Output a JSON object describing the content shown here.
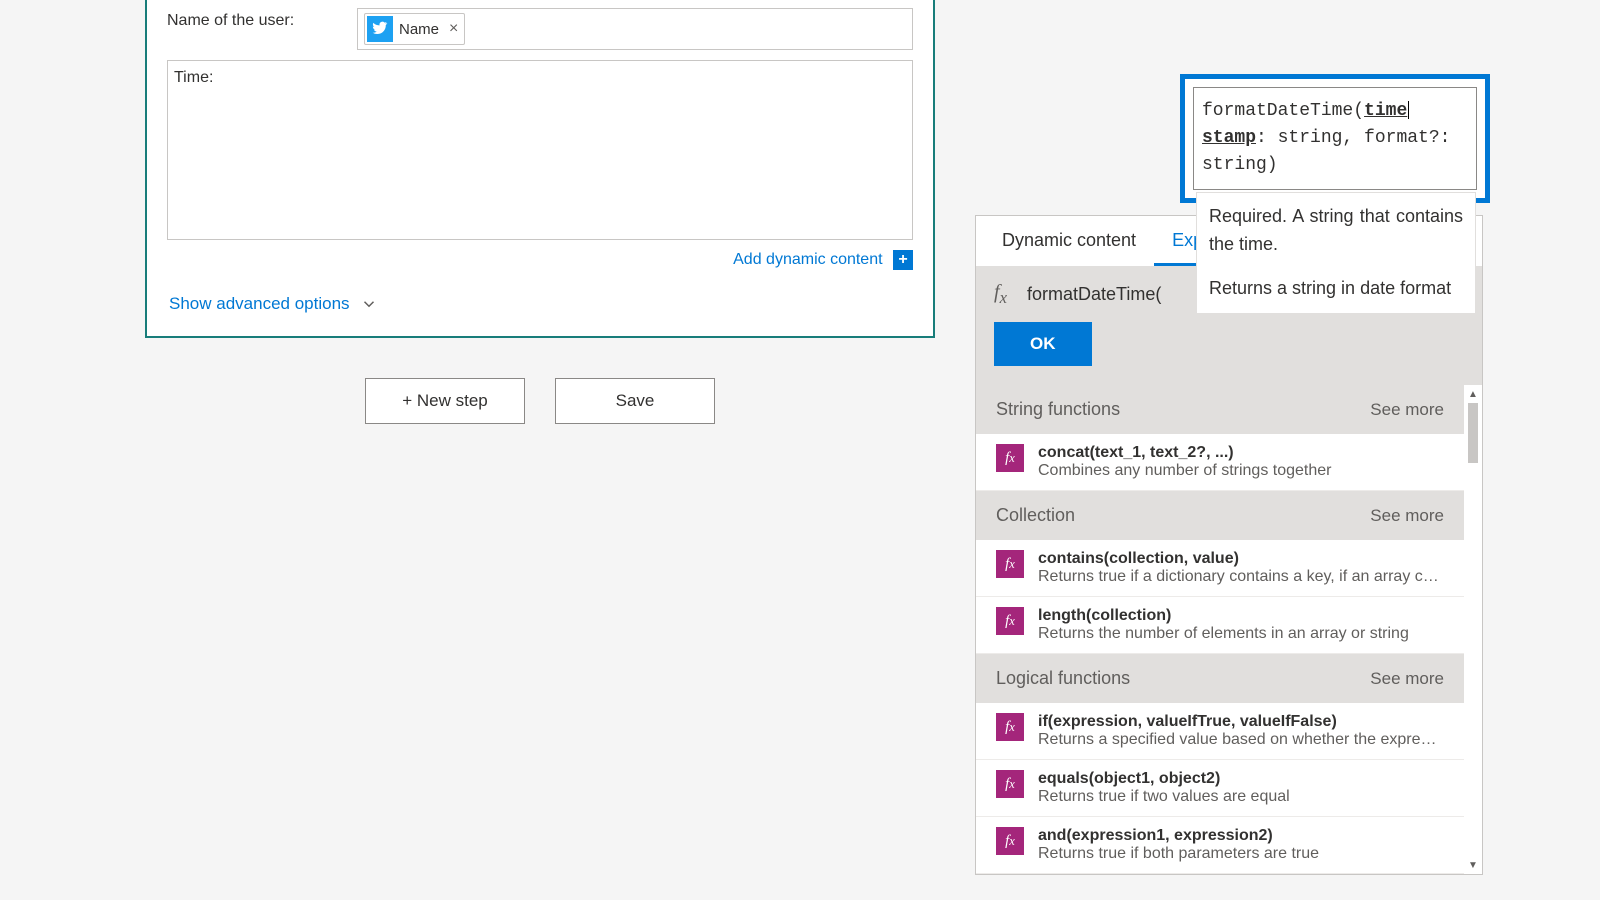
{
  "action_card": {
    "field1_label": "Name of the user:",
    "token_label": "Name",
    "field2_static_text": "Time:",
    "add_dynamic": "Add dynamic content",
    "show_advanced": "Show advanced options"
  },
  "step_buttons": {
    "new_step": "+ New step",
    "save": "Save"
  },
  "expression_panel": {
    "tab_dynamic": "Dynamic content",
    "tab_expression": "Expression",
    "fx_input_value": "formatDateTime(",
    "ok": "OK",
    "see_more": "See more",
    "categories": [
      {
        "title": "String functions",
        "items": [
          {
            "sig": "concat(text_1, text_2?, ...)",
            "desc": "Combines any number of strings together"
          }
        ]
      },
      {
        "title": "Collection",
        "items": [
          {
            "sig": "contains(collection, value)",
            "desc": "Returns true if a dictionary contains a key, if an array contains a value, or if a string contains a substring"
          },
          {
            "sig": "length(collection)",
            "desc": "Returns the number of elements in an array or string"
          }
        ]
      },
      {
        "title": "Logical functions",
        "items": [
          {
            "sig": "if(expression, valueIfTrue, valueIfFalse)",
            "desc": "Returns a specified value based on whether the expression resulted in true or false"
          },
          {
            "sig": "equals(object1, object2)",
            "desc": "Returns true if two values are equal"
          },
          {
            "sig": "and(expression1, expression2)",
            "desc": "Returns true if both parameters are true"
          }
        ]
      }
    ]
  },
  "tooltip": {
    "fn_name": "formatDateTime",
    "current_arg": "timestamp",
    "sig_tail": ": string, format?: string)",
    "required_text": "Required. A string that contains the time.",
    "returns_text": "Returns a string in date format"
  }
}
